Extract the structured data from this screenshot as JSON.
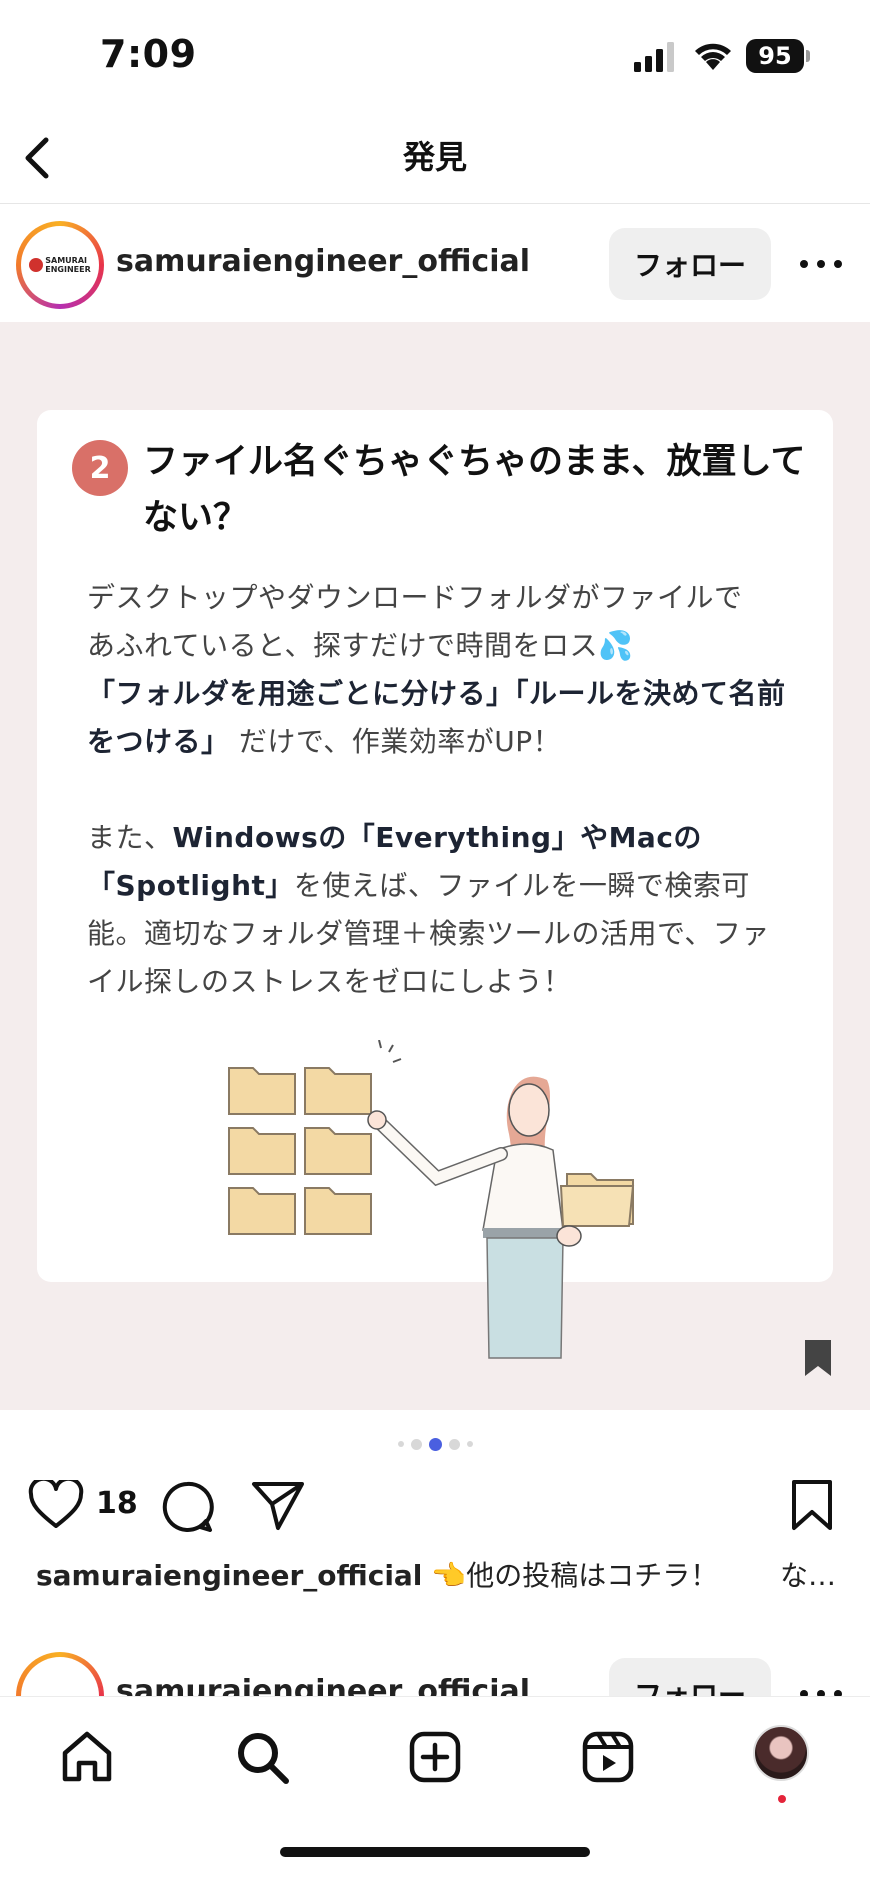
{
  "status_bar": {
    "time": "7:09",
    "battery": "95"
  },
  "nav": {
    "title": "発見"
  },
  "post": {
    "username": "samuraiengineer_official",
    "follow_label": "フォロー",
    "avatar_logo_text_1": "SAMURAI",
    "avatar_logo_text_2": "ENGINEER",
    "card": {
      "step_number": "2",
      "title": "ファイル名ぐちゃぐちゃのまま、放置してない？",
      "para1_line1": "デスクトップやダウンロードフォルダがファイルで",
      "para1_line2": "あふれていると、探すだけで時間をロス💦",
      "para1_bold": "「フォルダを用途ごとに分ける」「ルールを決めて名前をつける」",
      "para1_tail": "だけで、作業効率がUP！",
      "para2_head": "また、",
      "para2_bold1": "Windowsの「Everything」やMacの「Spotlight」",
      "para2_tail": "を使えば、ファイルを一瞬で検索可能。適切なフォルダ管理＋検索ツールの活用で、ファイル探しのストレスをゼロにしよう！"
    },
    "carousel": {
      "total": 5,
      "active_index": 2
    },
    "like_count": "18",
    "caption": {
      "username": "samuraiengineer_official",
      "text": "👈他の投稿はコチラ！",
      "more": "な…"
    }
  },
  "next_post": {
    "username": "samuraiengineer_official",
    "follow_label": "フォロー"
  },
  "tabs": [
    "home-icon",
    "search-icon",
    "create-icon",
    "reels-icon",
    "profile-avatar"
  ],
  "colors": {
    "badge": "#d97068",
    "post_bg": "#f4eded",
    "active_dot": "#4a5fe0",
    "notification": "#e4243a"
  }
}
